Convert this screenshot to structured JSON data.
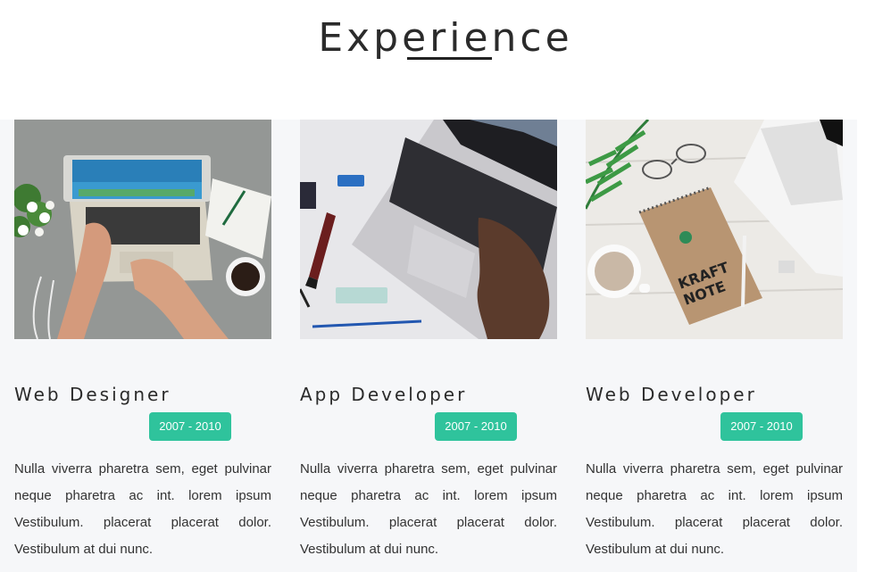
{
  "section": {
    "title": "Experience"
  },
  "cards": [
    {
      "title": "Web Designer",
      "years": "2007 - 2010",
      "description": "Nulla viverra pharetra sem, eget pulvinar neque pharetra ac int. lorem ipsum Vestibulum. placerat placerat dolor. Vestibulum at dui nunc."
    },
    {
      "title": "App Developer",
      "years": "2007 - 2010",
      "description": "Nulla viverra pharetra sem, eget pulvinar neque pharetra ac int. lorem ipsum Vestibulum. placerat placerat dolor. Vestibulum at dui nunc."
    },
    {
      "title": "Web Developer",
      "years": "2007 - 2010",
      "description": "Nulla viverra pharetra sem, eget pulvinar neque pharetra ac int. lorem ipsum Vestibulum. placerat placerat dolor. Vestibulum at dui nunc."
    }
  ],
  "colors": {
    "accent": "#2fc39c",
    "heading": "#2b2b2b",
    "panel": "#f6f7f9"
  }
}
